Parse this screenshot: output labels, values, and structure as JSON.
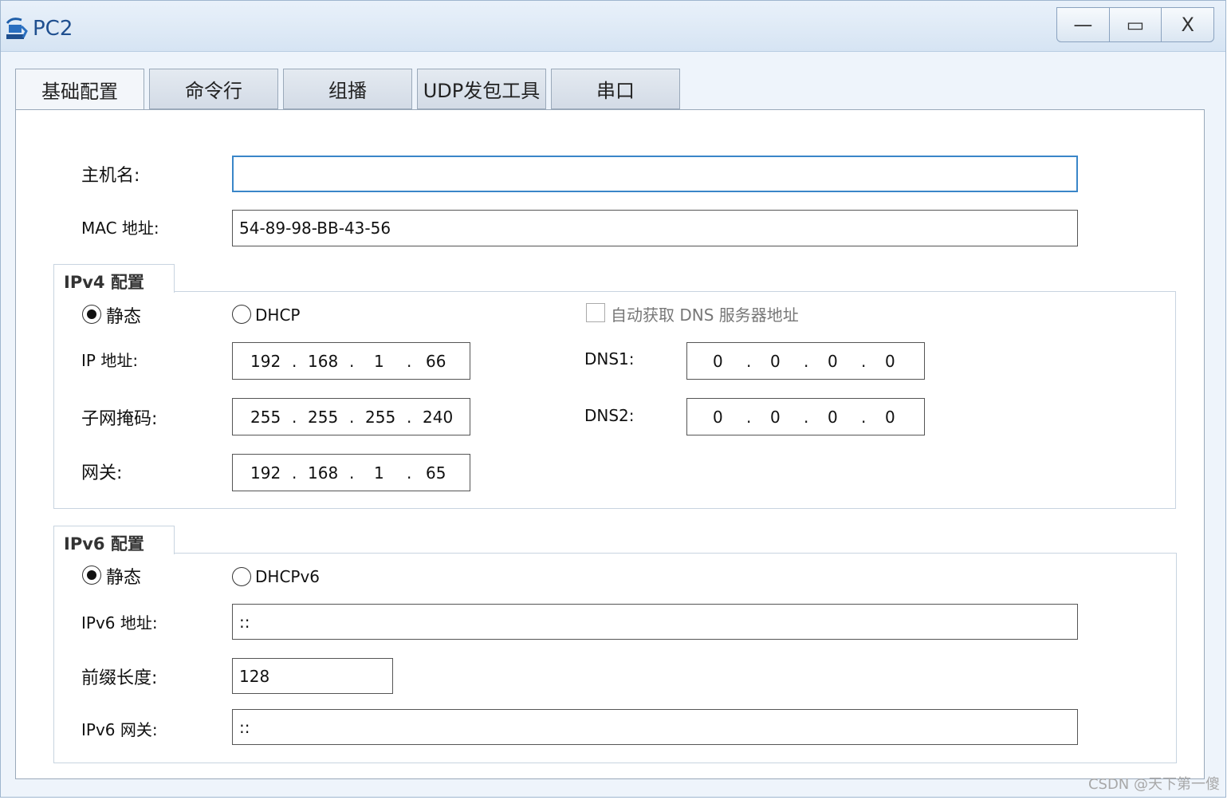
{
  "window": {
    "title": "PC2",
    "buttons": {
      "minimize": "—",
      "maximize": "▭",
      "close": "X"
    }
  },
  "tabs": [
    "基础配置",
    "命令行",
    "组播",
    "UDP发包工具",
    "串口"
  ],
  "basic": {
    "hostname_label": "主机名:",
    "hostname_value": "",
    "mac_label": "MAC 地址:",
    "mac_value": "54-89-98-BB-43-56"
  },
  "ipv4": {
    "group_title": "IPv4 配置",
    "static_label": "静态",
    "dhcp_label": "DHCP",
    "auto_dns_label": "自动获取 DNS 服务器地址",
    "ip_label": "IP 地址:",
    "ip": [
      "192",
      "168",
      "1",
      "66"
    ],
    "mask_label": "子网掩码:",
    "mask": [
      "255",
      "255",
      "255",
      "240"
    ],
    "gateway_label": "网关:",
    "gateway": [
      "192",
      "168",
      "1",
      "65"
    ],
    "dns1_label": "DNS1:",
    "dns1": [
      "0",
      "0",
      "0",
      "0"
    ],
    "dns2_label": "DNS2:",
    "dns2": [
      "0",
      "0",
      "0",
      "0"
    ],
    "static_selected": true
  },
  "ipv6": {
    "group_title": "IPv6 配置",
    "static_label": "静态",
    "dhcp_label": "DHCPv6",
    "address_label": "IPv6 地址:",
    "address_value": "::",
    "prefix_label": "前缀长度:",
    "prefix_value": "128",
    "gateway_label": "IPv6 网关:",
    "gateway_value": "::",
    "static_selected": true
  },
  "dot": ".",
  "watermark": "CSDN @天下第一傻"
}
